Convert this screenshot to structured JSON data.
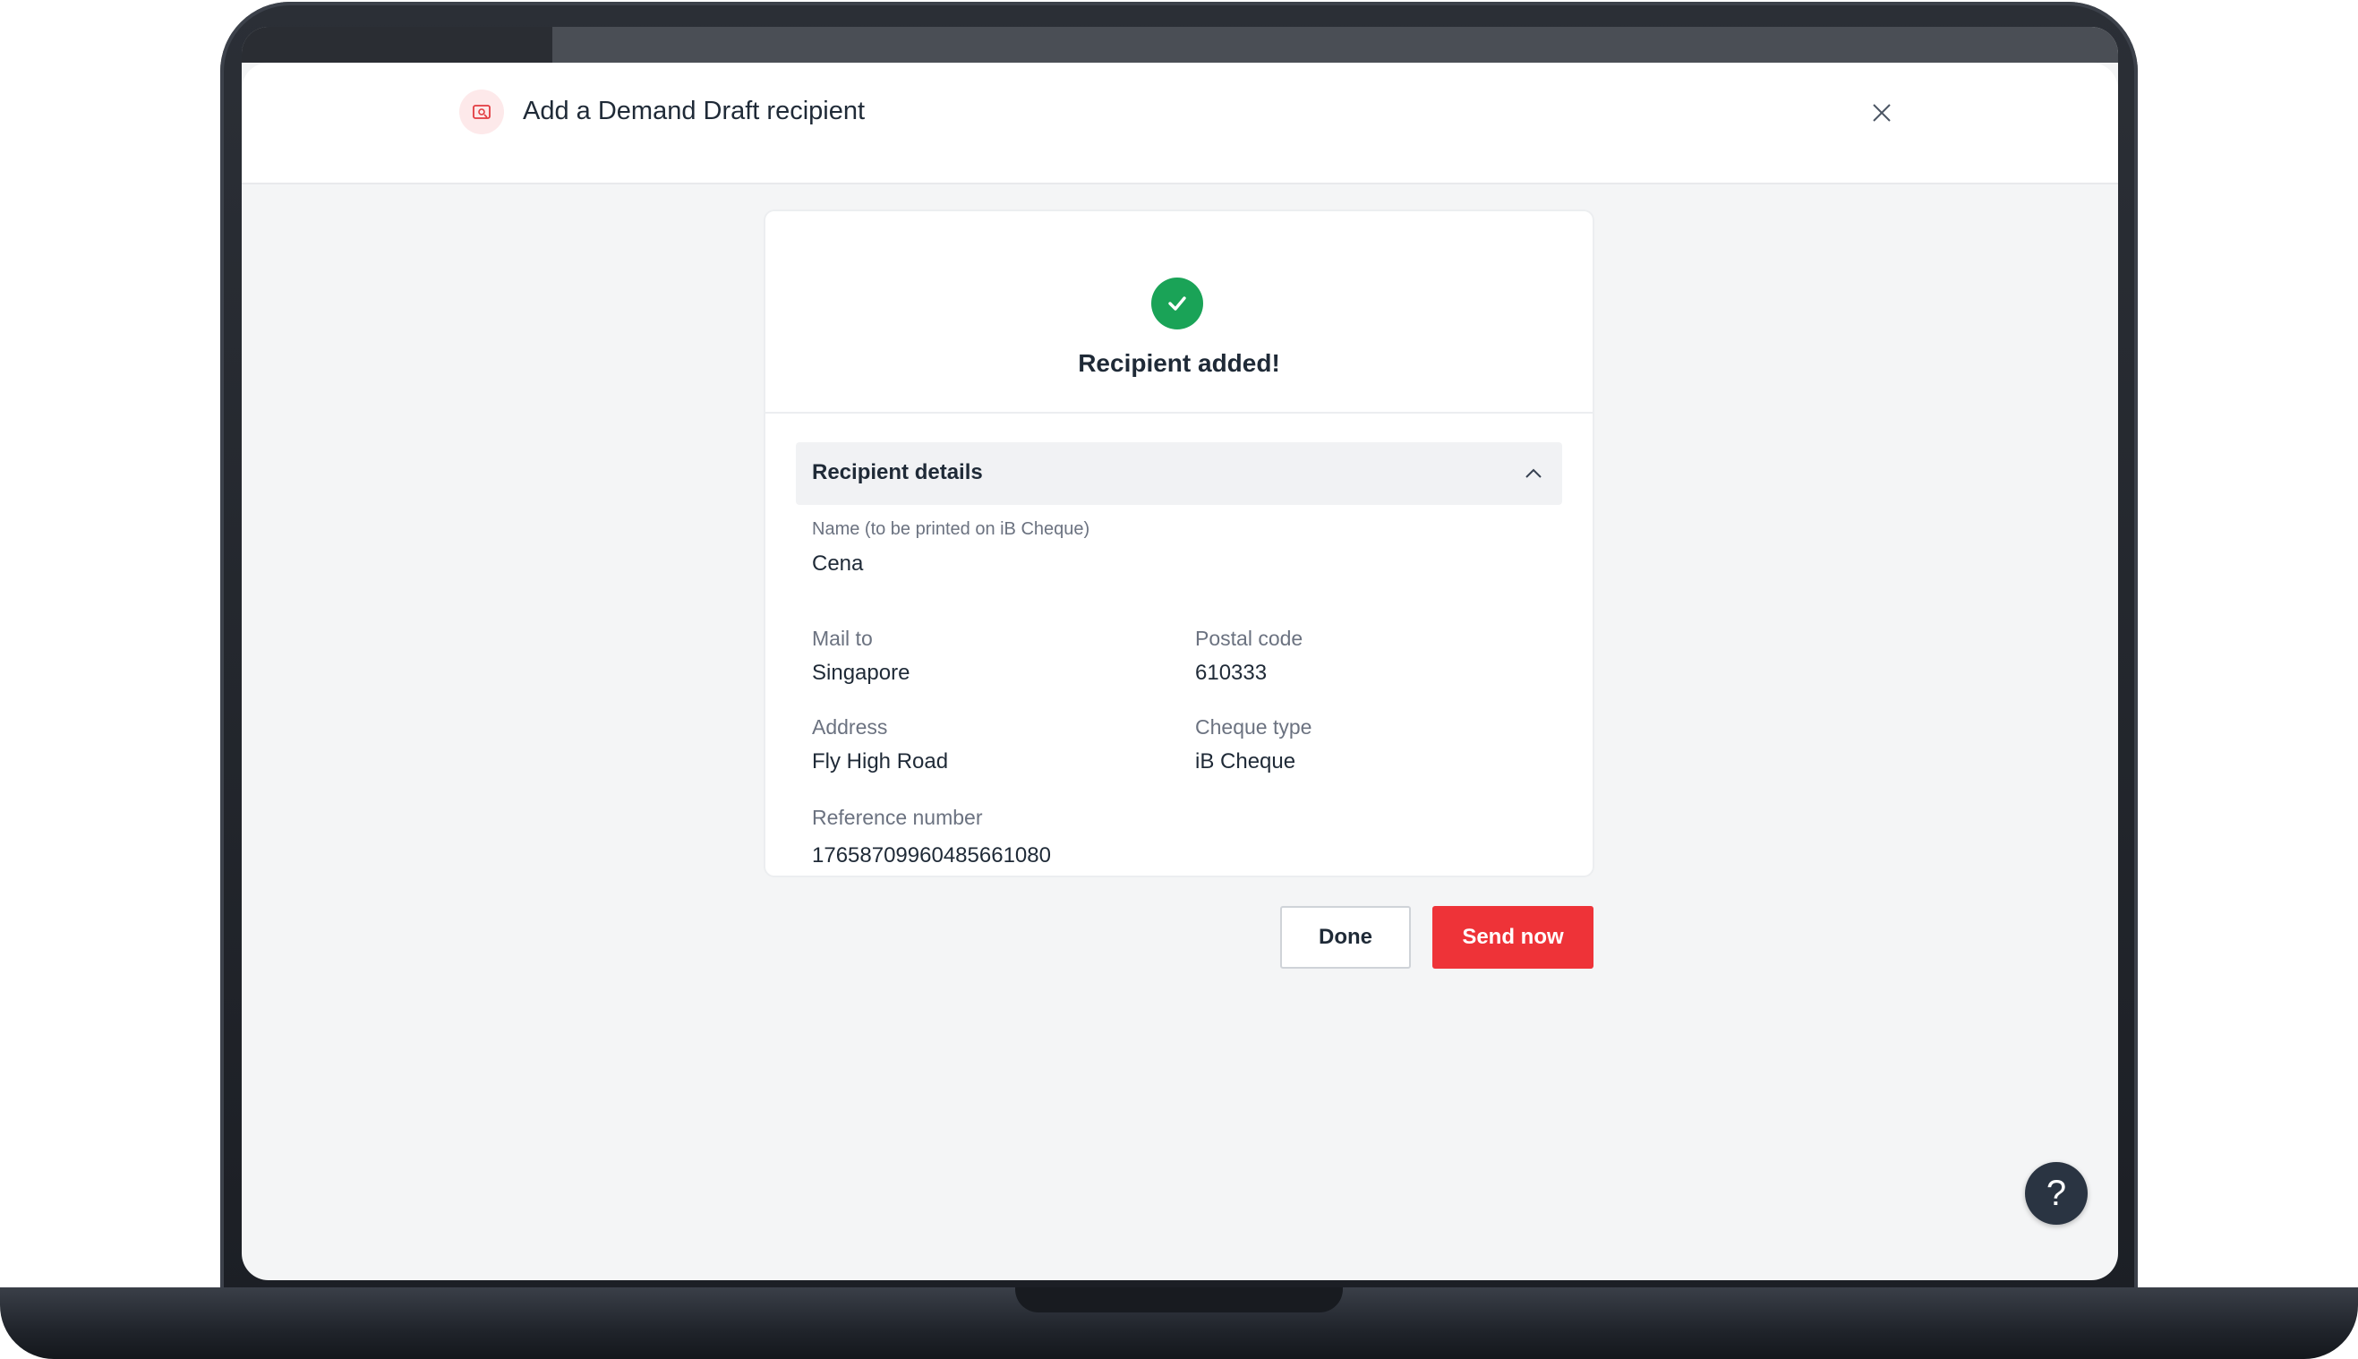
{
  "modal": {
    "title": "Add a Demand Draft recipient"
  },
  "success": {
    "title": "Recipient added!"
  },
  "recipient_details": {
    "section_title": "Recipient details",
    "name_label": "Name (to be printed on iB Cheque)",
    "name_value": "Cena",
    "mail_to_label": "Mail to",
    "mail_to_value": "Singapore",
    "postal_code_label": "Postal code",
    "postal_code_value": "610333",
    "address_label": "Address",
    "address_value": "Fly High Road",
    "cheque_type_label": "Cheque type",
    "cheque_type_value": "iB Cheque",
    "reference_label": "Reference number",
    "reference_value": "17658709960485661080"
  },
  "actions": {
    "done_label": "Done",
    "send_now_label": "Send now"
  },
  "help": {
    "label": "?"
  },
  "colors": {
    "accent_red": "#ee3338",
    "success_green": "#1aa357",
    "text_primary": "#1f2a37",
    "text_secondary": "#6b7280"
  },
  "icons": {
    "header": "cheque-icon",
    "close": "close-icon",
    "success": "check-circle-icon",
    "accordion": "chevron-up-icon",
    "help": "help-icon"
  }
}
